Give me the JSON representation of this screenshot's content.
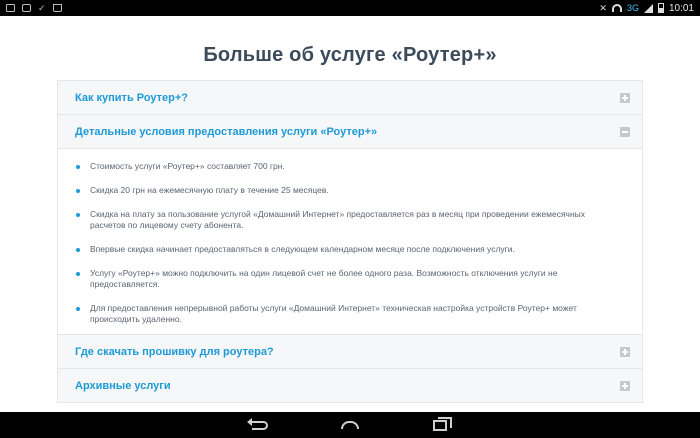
{
  "status_bar": {
    "icons_left": [
      "email-icon",
      "youtube-icon",
      "check-icon",
      "bag-icon"
    ],
    "network": "3G",
    "time": "10:01"
  },
  "page": {
    "title": "Больше об услуге «Роутер+»"
  },
  "accordion": {
    "items": [
      {
        "title": "Как купить Роутер+?",
        "expanded": false
      },
      {
        "title": "Детальные условия предоставления услуги «Роутер+»",
        "expanded": true
      },
      {
        "title": "Где скачать прошивку для роутера?",
        "expanded": false
      },
      {
        "title": "Архивные услуги",
        "expanded": false
      }
    ],
    "details": [
      "Стоимость услуги «Роутер+» составляет 700 грн.",
      "Скидка 20 грн на ежемесячную плату в течение 25 месяцев.",
      "Скидка на плату за пользование услугой «Домашний Интернет» предоставляется раз в месяц при проведении ежемесячных расчетов по лицевому счету абонента.",
      "Впервые скидка начинает предоставляться в следующем календарном месяце после подключения услуги.",
      "Услугу «Роутер+» можно подключить на один лицевой счет не более одного раза. Возможность отключения услуги не предоставляется.",
      "Для предоставления непрерывной работы услуги «Домашний Интернет» техническая настройка устройств Роутер+ может происходить удаленно."
    ]
  },
  "nav_bar": {
    "buttons": [
      "back-icon",
      "home-icon",
      "recent-apps-icon"
    ]
  },
  "colors": {
    "accent": "#1e9ad6",
    "title": "#3d4a5a",
    "text": "#5a6470",
    "header_bg": "#f6f7f8"
  }
}
